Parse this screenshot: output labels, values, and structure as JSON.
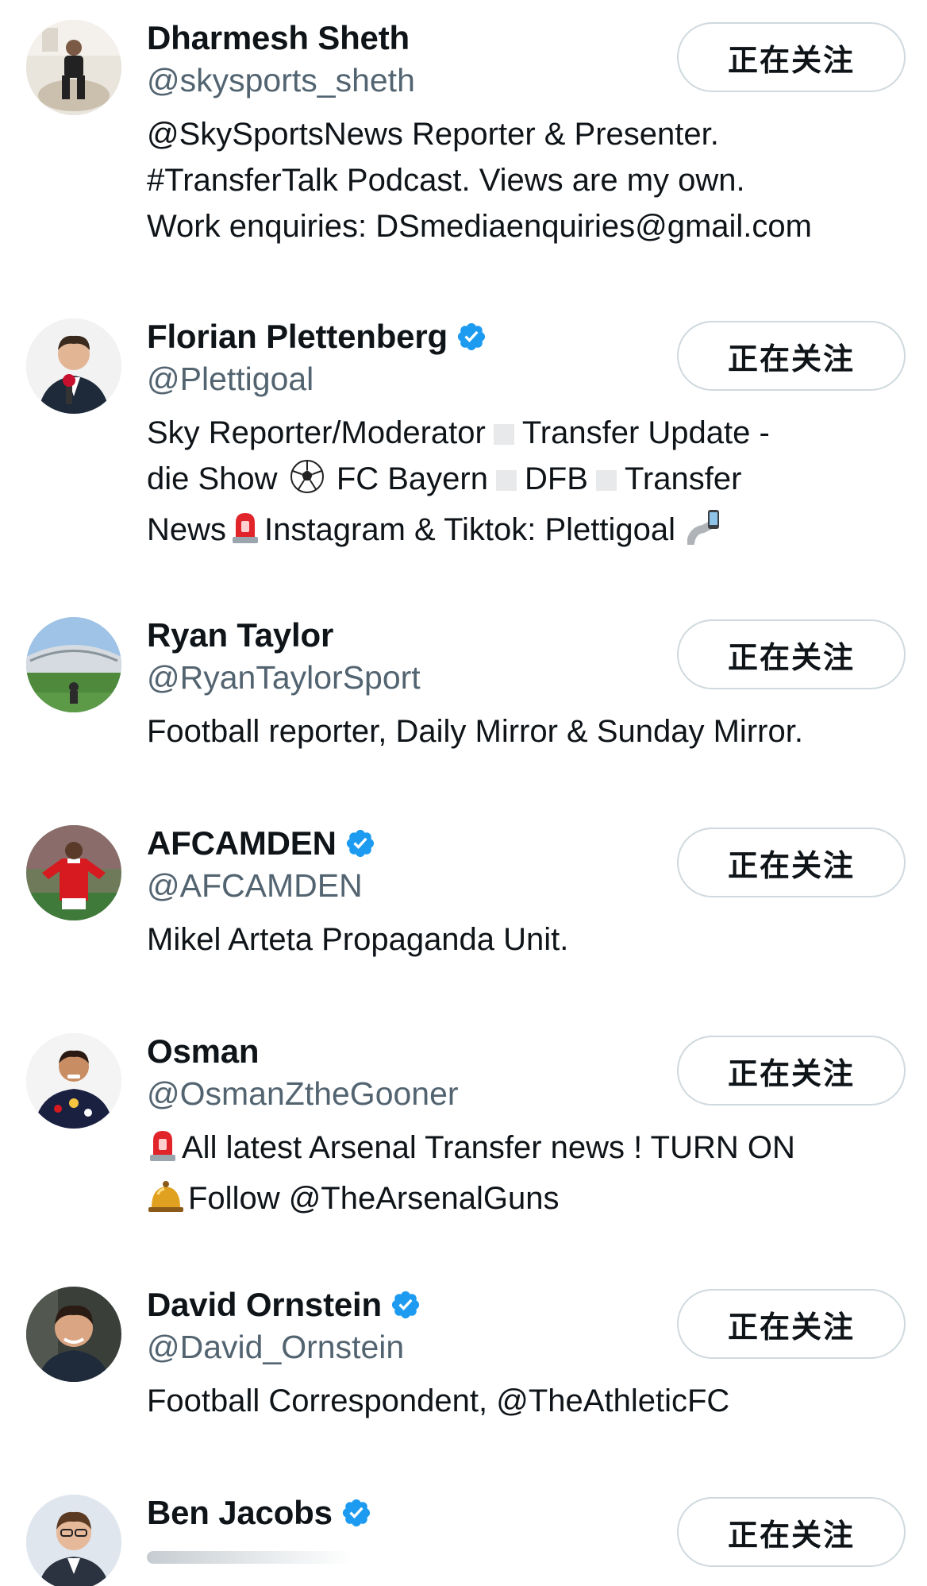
{
  "following_list": [
    {
      "name": "Dharmesh Sheth",
      "verified": false,
      "handle": "@skysports_sheth",
      "bio_lines": [
        "@SkySportsNews Reporter & Presenter.",
        "#TransferTalk Podcast. Views are my own.",
        "Work enquiries: DSmediaenquiries@gmail.com"
      ],
      "button": "正在关注"
    },
    {
      "name": "Florian Plettenberg",
      "verified": true,
      "handle": "@Plettigoal",
      "bio_parts": [
        "Sky Reporter/Moderator",
        "Transfer Update -",
        "die Show",
        "FC Bayern",
        "DFB",
        "Transfer",
        "News",
        "Instagram & Tiktok: Plettigoal"
      ],
      "button": "正在关注"
    },
    {
      "name": "Ryan Taylor",
      "verified": false,
      "handle": "@RyanTaylorSport",
      "bio": "Football reporter, Daily Mirror & Sunday Mirror.",
      "button": "正在关注"
    },
    {
      "name": "AFCAMDEN",
      "verified": true,
      "handle": "@AFCAMDEN",
      "bio": "Mikel Arteta Propaganda Unit.",
      "button": "正在关注"
    },
    {
      "name": "Osman",
      "verified": false,
      "handle": "@OsmanZtheGooner",
      "bio_parts": [
        "All latest Arsenal Transfer news ! TURN ON",
        "Follow @TheArsenalGuns"
      ],
      "button": "正在关注"
    },
    {
      "name": "David Ornstein",
      "verified": true,
      "handle": "@David_Ornstein",
      "bio": "Football Correspondent, @TheAthleticFC",
      "button": "正在关注"
    },
    {
      "name": "Ben Jacobs",
      "verified": true,
      "handle": "",
      "button": "正在关注"
    }
  ],
  "colors": {
    "verified": "#1d9bf0",
    "handle": "#536471",
    "button_border": "#cfd9de"
  },
  "icons": {
    "verified": "verified-badge-icon",
    "soccer": "soccer-ball-icon",
    "siren": "rotating-light-icon",
    "selfie": "selfie-phone-icon",
    "bell": "bell-icon"
  }
}
